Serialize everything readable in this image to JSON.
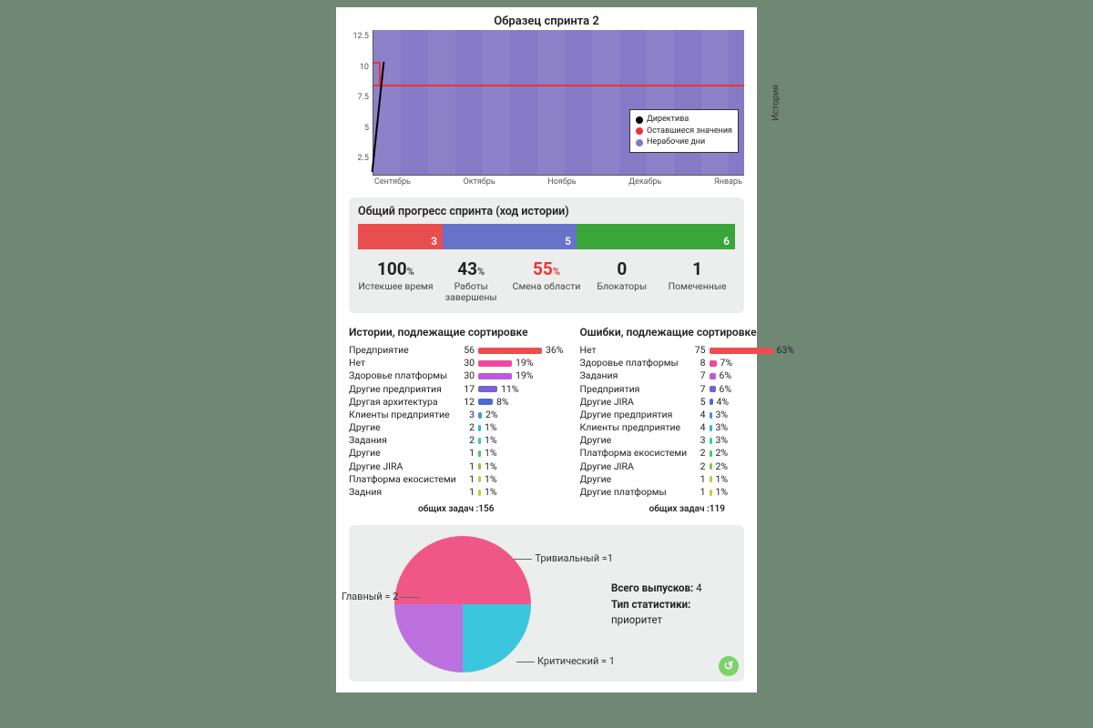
{
  "burndown": {
    "title": "Образец спринта 2",
    "ylabel": "История",
    "y_ticks": [
      "12.5",
      "10",
      "7.5",
      "5",
      "2.5"
    ],
    "x_ticks": [
      "Сентябрь",
      "Октябрь",
      "Ноябрь",
      "Декабрь",
      "Январь"
    ],
    "legend": {
      "directive": "Директива",
      "remaining": "Оставшиеся значения",
      "nonworking": "Нерабочие дни"
    }
  },
  "progress": {
    "title": "Общий прогресс спринта (ход истории)",
    "segments": [
      {
        "label": "3",
        "weight": 3,
        "color": "#e94e4e"
      },
      {
        "label": "5",
        "weight": 5,
        "color": "#6673c9"
      },
      {
        "label": "6",
        "weight": 6,
        "color": "#3aa63a"
      }
    ],
    "stats": [
      {
        "value": "100",
        "unit": "%",
        "label": "Истекшее время"
      },
      {
        "value": "43",
        "unit": "%",
        "label": "Работы завершены"
      },
      {
        "value": "55",
        "unit": "%",
        "label": "Смена области",
        "red": true
      },
      {
        "value": "0",
        "unit": "",
        "label": "Блокаторы"
      },
      {
        "value": "1",
        "unit": "",
        "label": "Помеченные"
      }
    ]
  },
  "stories": {
    "title": "Истории, подлежащие сортировке",
    "total_label": "общих задач :",
    "total": 156,
    "items": [
      {
        "name": "Предприятие",
        "count": 56,
        "pct": 36,
        "color": "#ef4d4d"
      },
      {
        "name": "Нет",
        "count": 30,
        "pct": 19,
        "color": "#ec4aa0"
      },
      {
        "name": "Здоровье платформы",
        "count": 30,
        "pct": 19,
        "color": "#b95ae0"
      },
      {
        "name": "Другие предприятия",
        "count": 17,
        "pct": 11,
        "color": "#7b5fd6"
      },
      {
        "name": "Другая архитектура",
        "count": 12,
        "pct": 8,
        "color": "#4c6ad6"
      },
      {
        "name": "Клиенты предприятие",
        "count": 3,
        "pct": 2,
        "color": "#3a98d6"
      },
      {
        "name": "Другие",
        "count": 2,
        "pct": 1,
        "color": "#2bbad1"
      },
      {
        "name": "Задания",
        "count": 2,
        "pct": 1,
        "color": "#2bd1b0"
      },
      {
        "name": "Другие",
        "count": 1,
        "pct": 1,
        "color": "#46c96a"
      },
      {
        "name": "Другие JIRA",
        "count": 1,
        "pct": 1,
        "color": "#7dc94a"
      },
      {
        "name": "Платформа екосистеми",
        "count": 1,
        "pct": 1,
        "color": "#b8ce45"
      },
      {
        "name": "Задния",
        "count": 1,
        "pct": 1,
        "color": "#d6c13f"
      }
    ]
  },
  "bugs": {
    "title": "Ошибки, подлежащие сортировке",
    "total_label": "общих задач :",
    "total": 119,
    "items": [
      {
        "name": "Нет",
        "count": 75,
        "pct": 63,
        "color": "#ef4d4d"
      },
      {
        "name": "Здоровье платформы",
        "count": 8,
        "pct": 7,
        "color": "#ec4aa0"
      },
      {
        "name": "Задания",
        "count": 7,
        "pct": 6,
        "color": "#b95ae0"
      },
      {
        "name": "Предприятия",
        "count": 7,
        "pct": 6,
        "color": "#7b5fd6"
      },
      {
        "name": "Другие JIRA",
        "count": 5,
        "pct": 4,
        "color": "#4c6ad6"
      },
      {
        "name": "Другие предприятия",
        "count": 4,
        "pct": 3,
        "color": "#3a98d6"
      },
      {
        "name": "Клиенты предприятие",
        "count": 4,
        "pct": 3,
        "color": "#2bbad1"
      },
      {
        "name": "Другие",
        "count": 3,
        "pct": 3,
        "color": "#2bd1b0"
      },
      {
        "name": "Платформа екосистеми",
        "count": 2,
        "pct": 2,
        "color": "#46c96a"
      },
      {
        "name": "Другие JIRA",
        "count": 2,
        "pct": 2,
        "color": "#7dc94a"
      },
      {
        "name": "Другие",
        "count": 1,
        "pct": 1,
        "color": "#b8ce45"
      },
      {
        "name": "Другие платформы",
        "count": 1,
        "pct": 1,
        "color": "#d6c13f"
      }
    ]
  },
  "pie": {
    "total_label": "Всего выпусков:",
    "total": 4,
    "stat_type_label": "Тип статистики:",
    "stat_type": "приоритет",
    "slices": [
      {
        "label": "Главный = 2",
        "value": 2,
        "color": "#ef5788"
      },
      {
        "label": "Тривиальный =1",
        "value": 1,
        "color": "#bd71df"
      },
      {
        "label": "Критический = 1",
        "value": 1,
        "color": "#3cc6dd"
      }
    ]
  },
  "chart_data": [
    {
      "type": "line",
      "title": "Образец спринта 2",
      "ylabel": "История",
      "x": [
        "Сентябрь",
        "Октябрь",
        "Ноябрь",
        "Декабрь",
        "Январь"
      ],
      "ylim": [
        0,
        12.5
      ],
      "series": [
        {
          "name": "Директива",
          "values": [
            10,
            0,
            null,
            null,
            null
          ]
        },
        {
          "name": "Оставшиеся значения",
          "values": [
            10,
            8,
            8,
            8,
            8
          ]
        }
      ],
      "annotations": [
        "Нерабочие дни"
      ]
    },
    {
      "type": "bar",
      "title": "Общий прогресс спринта (ход истории)",
      "categories": [
        "red",
        "blue",
        "green"
      ],
      "values": [
        3,
        5,
        6
      ]
    },
    {
      "type": "bar",
      "title": "Истории, подлежащие сортировке",
      "categories": [
        "Предприятие",
        "Нет",
        "Здоровье платформы",
        "Другие предприятия",
        "Другая архитектура",
        "Клиенты предприятие",
        "Другие",
        "Задания",
        "Другие",
        "Другие JIRA",
        "Платформа екосистеми",
        "Задния"
      ],
      "values": [
        56,
        30,
        30,
        17,
        12,
        3,
        2,
        2,
        1,
        1,
        1,
        1
      ],
      "percent": [
        36,
        19,
        19,
        11,
        8,
        2,
        1,
        1,
        1,
        1,
        1,
        1
      ],
      "total": 156
    },
    {
      "type": "bar",
      "title": "Ошибки, подлежащие сортировке",
      "categories": [
        "Нет",
        "Здоровье платформы",
        "Задания",
        "Предприятия",
        "Другие JIRA",
        "Другие предприятия",
        "Клиенты предприятие",
        "Другие",
        "Платформа екосистеми",
        "Другие JIRA",
        "Другие",
        "Другие платформы"
      ],
      "values": [
        75,
        8,
        7,
        7,
        5,
        4,
        4,
        3,
        2,
        2,
        1,
        1
      ],
      "percent": [
        63,
        7,
        6,
        6,
        4,
        3,
        3,
        3,
        2,
        2,
        1,
        1
      ],
      "total": 119
    },
    {
      "type": "pie",
      "title": "Всего выпусков: 4 — Тип статистики: приоритет",
      "categories": [
        "Главный",
        "Тривиальный",
        "Критический"
      ],
      "values": [
        2,
        1,
        1
      ]
    }
  ]
}
